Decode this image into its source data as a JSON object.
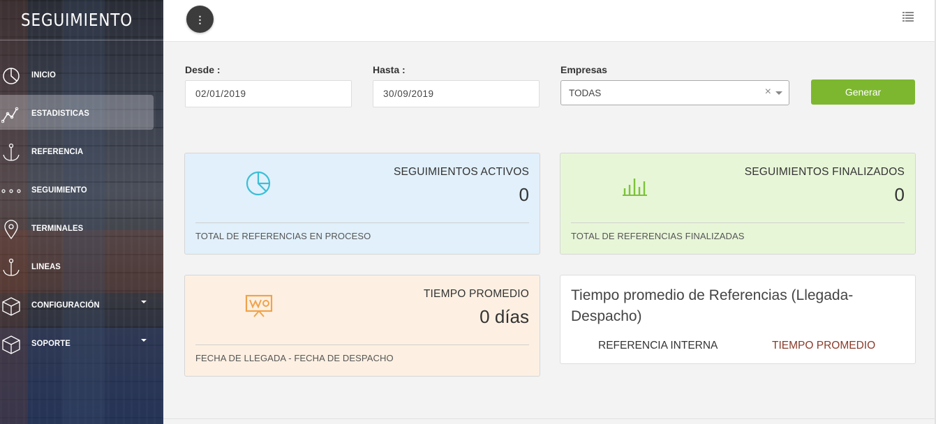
{
  "app": {
    "brand": "SEGUIMIENTO"
  },
  "sidebar": {
    "items": [
      {
        "label": "INICIO",
        "icon": "pie-chart-icon"
      },
      {
        "label": "ESTADISTICAS",
        "icon": "line-chart-icon",
        "active": true
      },
      {
        "label": "REFERENCIA",
        "icon": "anchor-icon"
      },
      {
        "label": "SEGUIMIENTO",
        "icon": "dots-icon"
      },
      {
        "label": "TERMINALES",
        "icon": "map-pin-icon"
      },
      {
        "label": "LINEAS",
        "icon": "anchor-icon"
      },
      {
        "label": "CONFIGURACIÓN",
        "icon": "cube-icon",
        "has_submenu": true
      },
      {
        "label": "SOPORTE",
        "icon": "cube-icon",
        "has_submenu": true
      }
    ]
  },
  "topbar": {
    "menu_button": "⋮",
    "list_icon": "list-icon"
  },
  "filters": {
    "desde_label": "Desde :",
    "desde_value": "02/01/2019",
    "hasta_label": "Hasta :",
    "hasta_value": "30/09/2019",
    "empresas_label": "Empresas",
    "empresas_value": "TODAS",
    "clear_symbol": "×",
    "generar_label": "Generar"
  },
  "cards": {
    "activos": {
      "title": "SEGUIMIENTOS ACTIVOS",
      "value": "0",
      "footer": "TOTAL DE REFERENCIAS EN PROCESO",
      "icon": "pie-chart-icon",
      "color": "#3bbfd6"
    },
    "finalizados": {
      "title": "SEGUIMIENTOS FINALIZADOS",
      "value": "0",
      "footer": "TOTAL DE REFERENCIAS FINALIZADAS",
      "icon": "bar-chart-icon",
      "color": "#7cc33a"
    },
    "tiempo": {
      "title": "TIEMPO PROMEDIO",
      "value": "0 días",
      "footer": "FECHA DE LLEGADA - FECHA DE DESPACHO",
      "icon": "presentation-board-icon",
      "color": "#f0a34a"
    }
  },
  "table": {
    "title": "Tiempo promedio de Referencias (Llegada-Despacho)",
    "columns": [
      "REFERENCIA INTERNA",
      "TIEMPO PROMEDIO"
    ]
  }
}
